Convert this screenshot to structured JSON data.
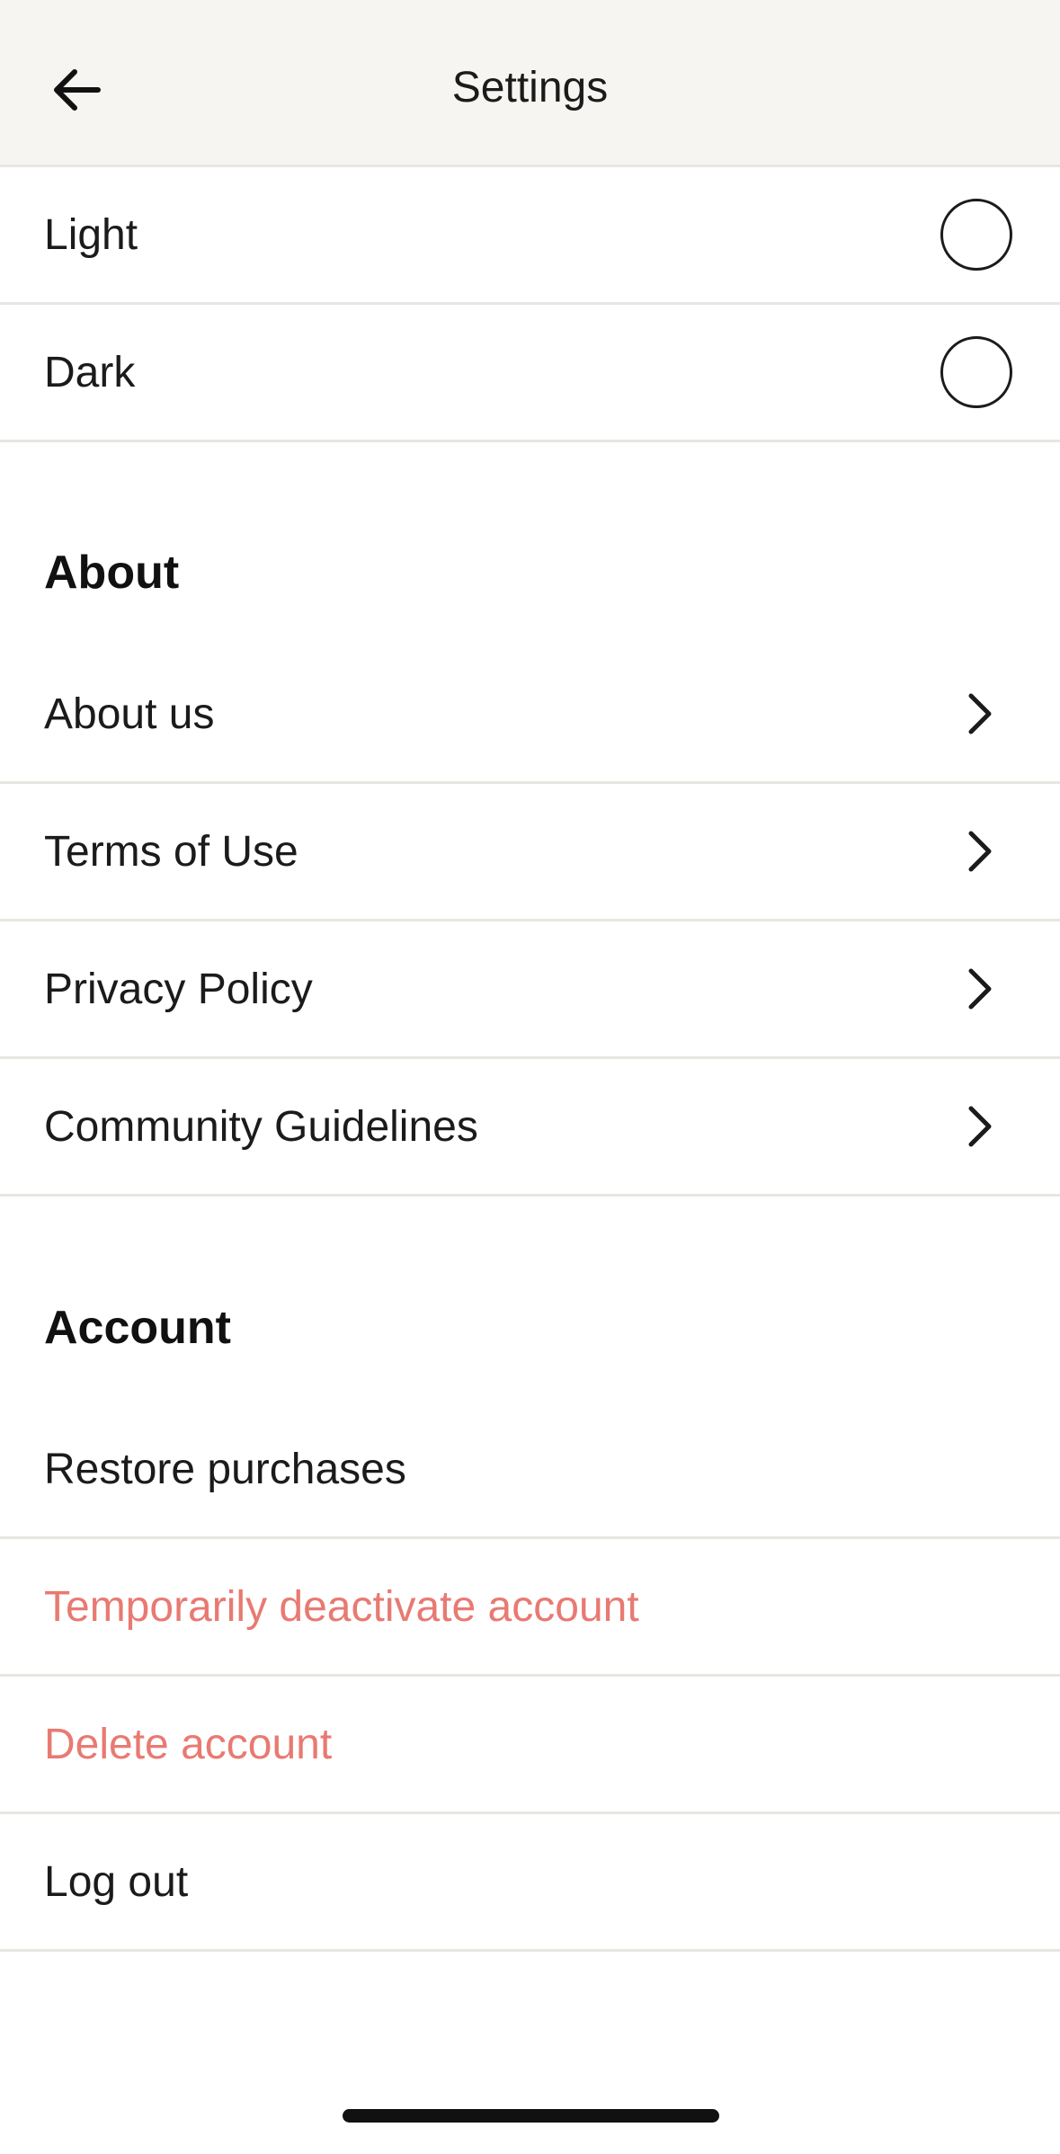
{
  "header": {
    "title": "Settings",
    "back_icon": "arrow-left-icon"
  },
  "appearance": {
    "options": [
      {
        "label": "Light",
        "selected": false
      },
      {
        "label": "Dark",
        "selected": false
      }
    ]
  },
  "about": {
    "title": "About",
    "items": [
      {
        "label": "About us"
      },
      {
        "label": "Terms of Use"
      },
      {
        "label": "Privacy Policy"
      },
      {
        "label": "Community Guidelines"
      }
    ],
    "item_icon": "chevron-right-icon"
  },
  "account": {
    "title": "Account",
    "items": [
      {
        "label": "Restore purchases"
      },
      {
        "label": "Temporarily deactivate account"
      },
      {
        "label": "Delete account"
      },
      {
        "label": "Log out"
      }
    ]
  },
  "colors": {
    "danger": "#e87a72",
    "header_bg": "#f6f5f2",
    "divider": "#e8e6e1"
  }
}
